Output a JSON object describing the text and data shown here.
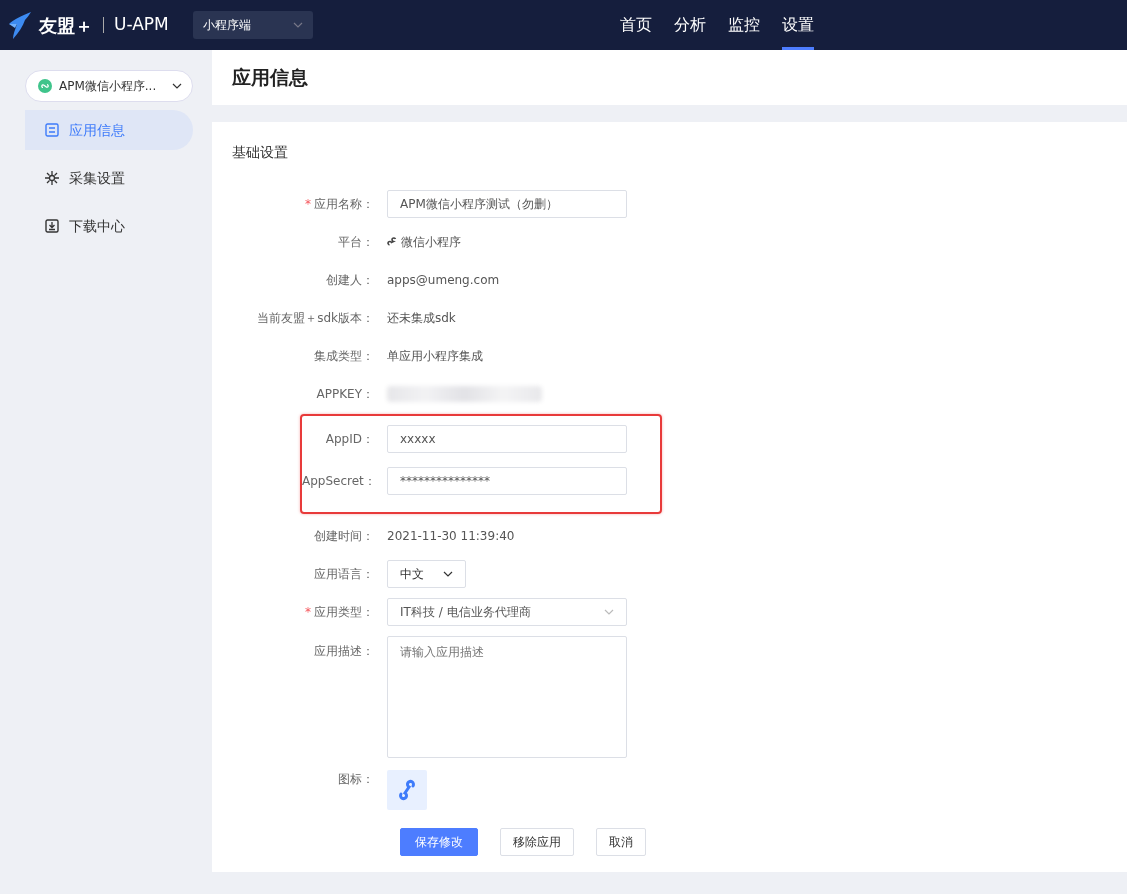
{
  "navbar": {
    "brand": "友盟＋",
    "product": "U-APM",
    "platform_select": "小程序端",
    "tabs": [
      {
        "label": "首页",
        "selected": false
      },
      {
        "label": "分析",
        "selected": false
      },
      {
        "label": "监控",
        "selected": false
      },
      {
        "label": "设置",
        "selected": true
      }
    ]
  },
  "sidebar": {
    "app_select": "APM微信小程序...",
    "items": [
      {
        "label": "应用信息",
        "selected": true
      },
      {
        "label": "采集设置",
        "selected": false
      },
      {
        "label": "下载中心",
        "selected": false
      }
    ]
  },
  "page_title": "应用信息",
  "section_title": "基础设置",
  "fields": [
    {
      "label": "应用名称：",
      "required_mark": "*",
      "kind": "input",
      "value": "APM微信小程序测试（勿删）",
      "highlighted": false
    },
    {
      "label": "平台：",
      "kind": "platform",
      "value": "微信小程序",
      "highlighted": false
    },
    {
      "label": "创建人：",
      "kind": "text",
      "value": "apps@umeng.com",
      "highlighted": false
    },
    {
      "label": "当前友盟＋sdk版本：",
      "kind": "text",
      "value": "还未集成sdk",
      "highlighted": false
    },
    {
      "label": "集成类型：",
      "kind": "text",
      "value": "单应用小程序集成",
      "highlighted": false
    },
    {
      "label": "APPKEY：",
      "kind": "blurred",
      "highlighted": false
    },
    {
      "label": "AppID：",
      "kind": "input",
      "value": "xxxxx",
      "highlighted": true
    },
    {
      "label": "AppSecret：",
      "kind": "input",
      "value": "***************",
      "highlighted": true
    },
    {
      "label": "创建时间：",
      "kind": "text",
      "value": "2021-11-30 11:39:40",
      "highlighted": false
    },
    {
      "label": "应用语言：",
      "kind": "small-select",
      "value": "中文",
      "highlighted": false
    },
    {
      "label": "应用类型：",
      "required_mark": "*",
      "kind": "select",
      "value": "IT科技 / 电信业务代理商",
      "highlighted": false
    },
    {
      "label": "应用描述：",
      "kind": "textarea",
      "placeholder": "请输入应用描述",
      "highlighted": false
    },
    {
      "label": "图标：",
      "kind": "icon",
      "highlighted": false
    }
  ],
  "buttons": [
    {
      "label": "保存修改",
      "kind": "primary"
    },
    {
      "label": "移除应用",
      "kind": "secondary"
    },
    {
      "label": "取消",
      "kind": "secondary"
    }
  ]
}
